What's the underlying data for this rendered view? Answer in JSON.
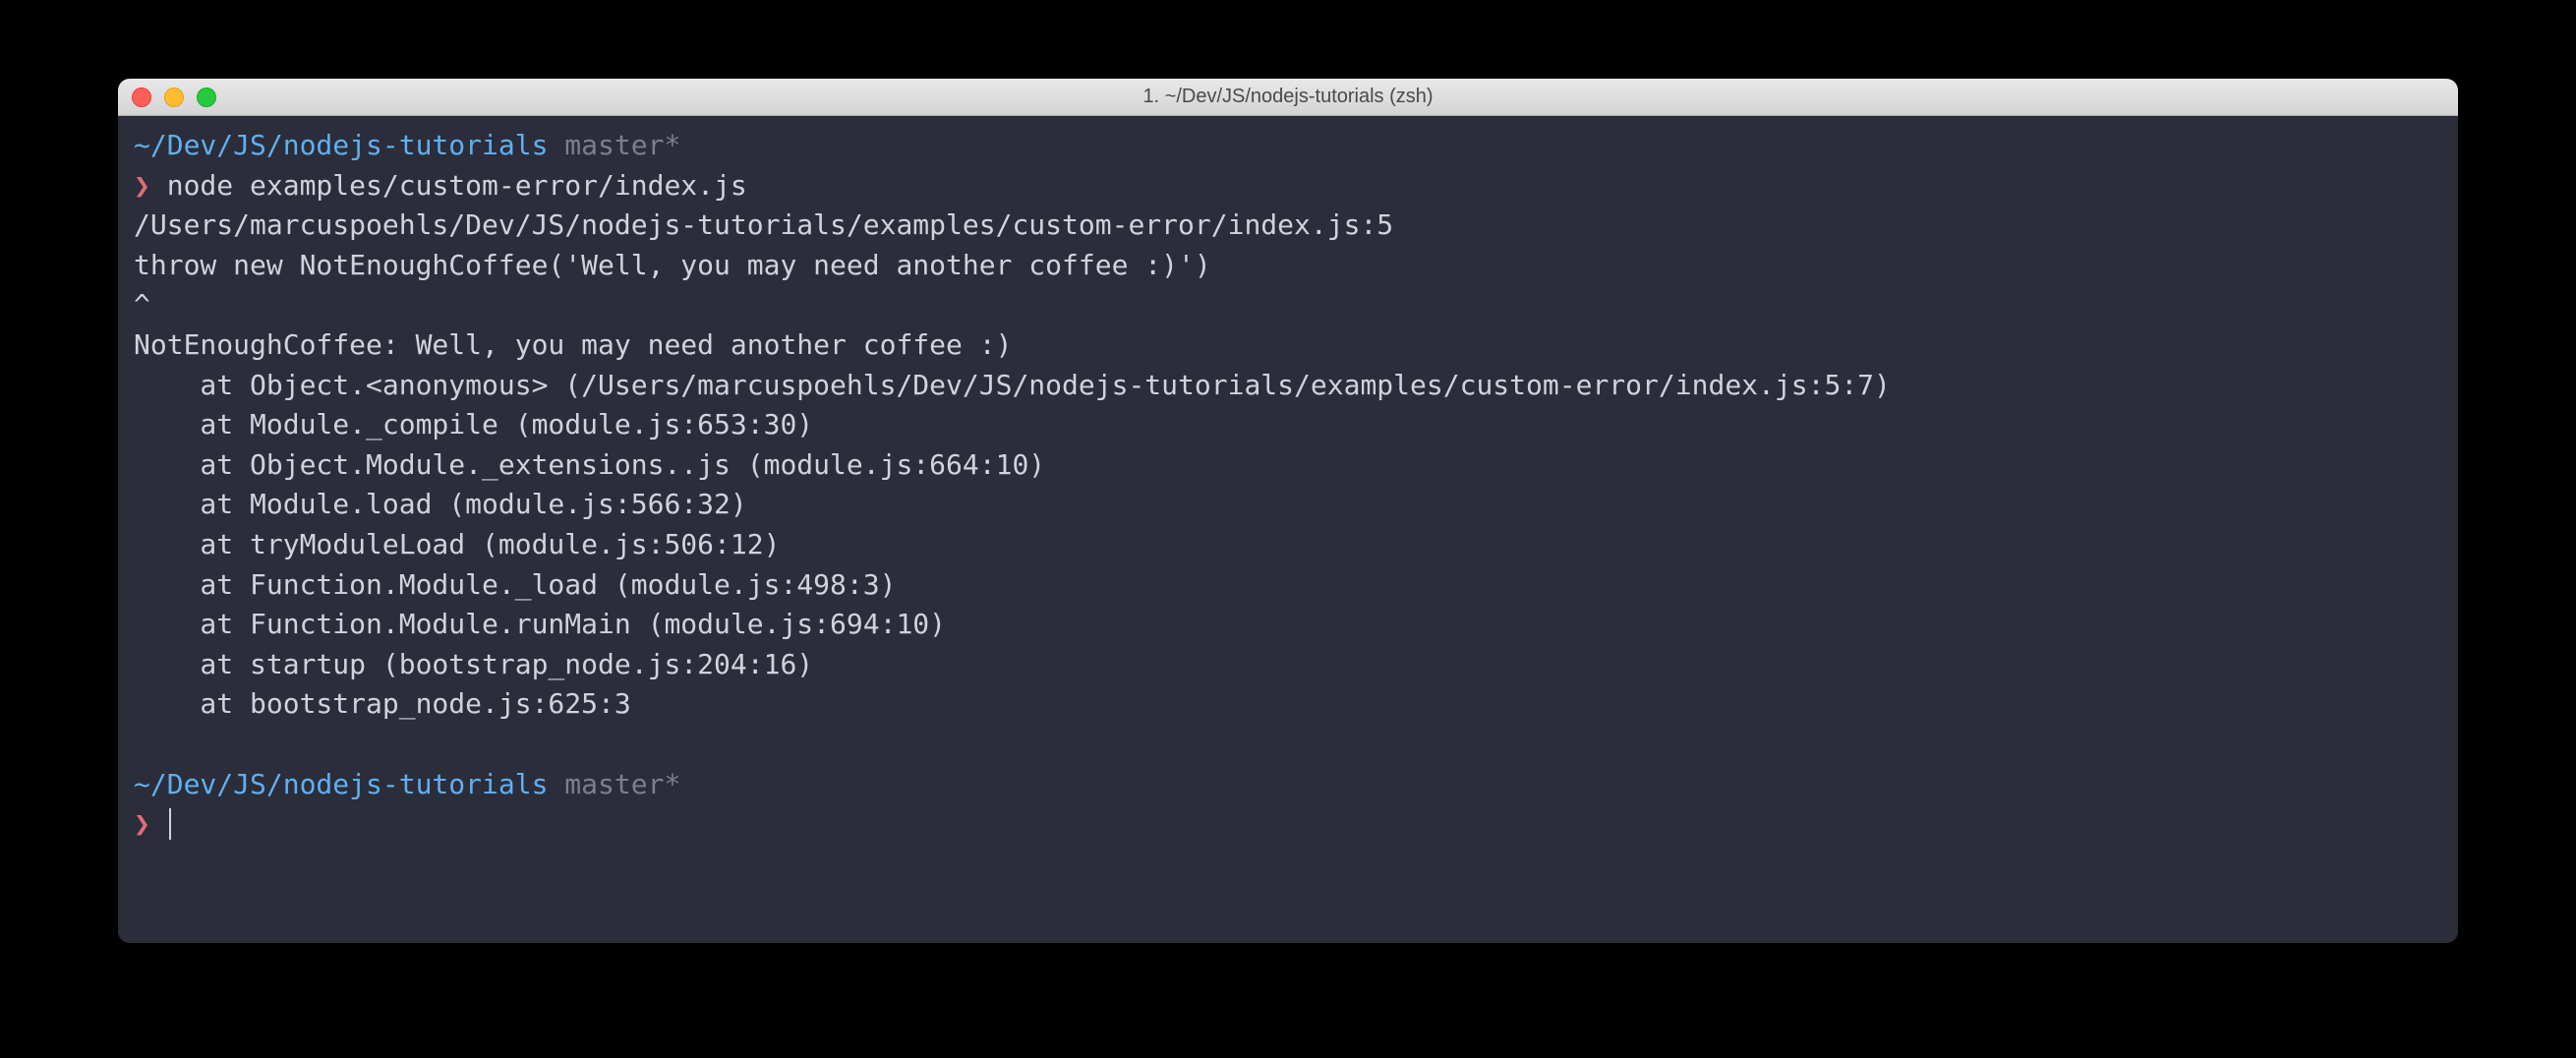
{
  "titlebar": {
    "title": "1. ~/Dev/JS/nodejs-tutorials (zsh)"
  },
  "prompt1": {
    "path": "~/Dev/JS/nodejs-tutorials",
    "branch": "master*",
    "char": "❯",
    "command": "node examples/custom-error/index.js"
  },
  "output": {
    "l1": "/Users/marcuspoehls/Dev/JS/nodejs-tutorials/examples/custom-error/index.js:5",
    "l2": "throw new NotEnoughCoffee('Well, you may need another coffee :)')",
    "l3": "^",
    "l4": "",
    "l5": "NotEnoughCoffee: Well, you may need another coffee :)",
    "l6": "    at Object.<anonymous> (/Users/marcuspoehls/Dev/JS/nodejs-tutorials/examples/custom-error/index.js:5:7)",
    "l7": "    at Module._compile (module.js:653:30)",
    "l8": "    at Object.Module._extensions..js (module.js:664:10)",
    "l9": "    at Module.load (module.js:566:32)",
    "l10": "    at tryModuleLoad (module.js:506:12)",
    "l11": "    at Function.Module._load (module.js:498:3)",
    "l12": "    at Function.Module.runMain (module.js:694:10)",
    "l13": "    at startup (bootstrap_node.js:204:16)",
    "l14": "    at bootstrap_node.js:625:3"
  },
  "prompt2": {
    "path": "~/Dev/JS/nodejs-tutorials",
    "branch": "master*",
    "char": "❯"
  }
}
